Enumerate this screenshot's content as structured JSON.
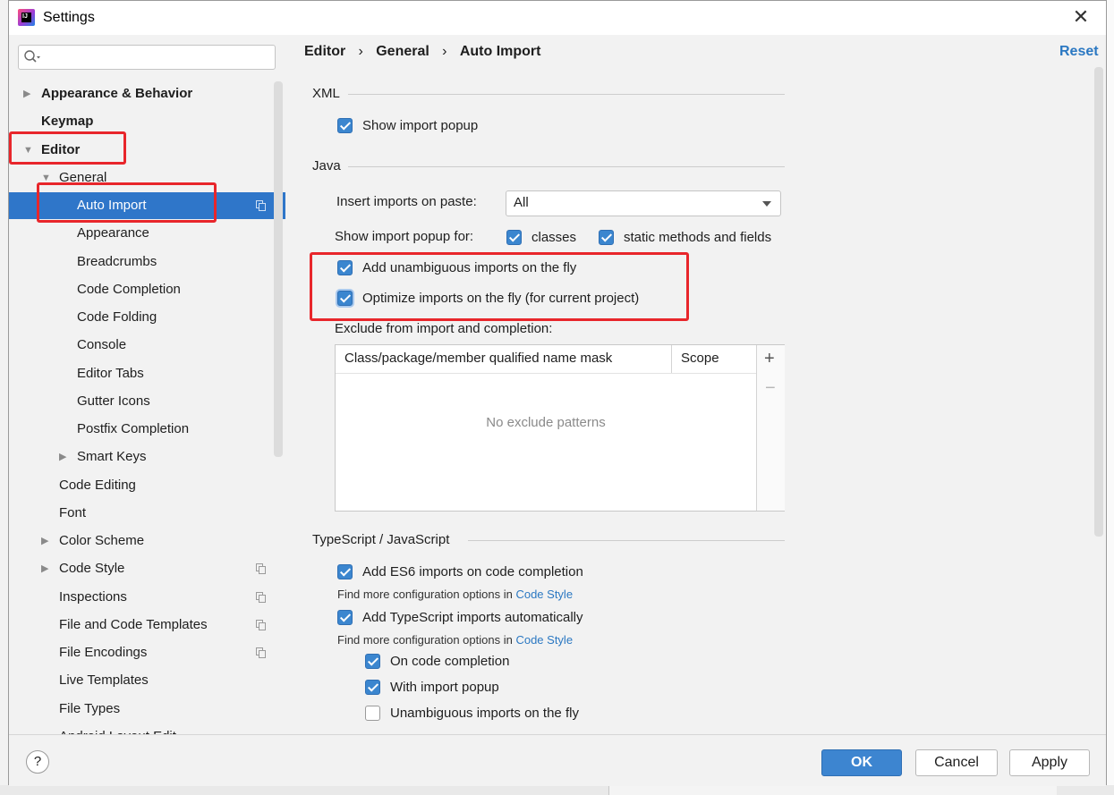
{
  "window": {
    "title": "Settings"
  },
  "search": {
    "placeholder": ""
  },
  "tree": {
    "items": [
      {
        "label": "Appearance & Behavior"
      },
      {
        "label": "Keymap"
      },
      {
        "label": "Editor"
      },
      {
        "label": "General"
      },
      {
        "label": "Auto Import"
      },
      {
        "label": "Appearance"
      },
      {
        "label": "Breadcrumbs"
      },
      {
        "label": "Code Completion"
      },
      {
        "label": "Code Folding"
      },
      {
        "label": "Console"
      },
      {
        "label": "Editor Tabs"
      },
      {
        "label": "Gutter Icons"
      },
      {
        "label": "Postfix Completion"
      },
      {
        "label": "Smart Keys"
      },
      {
        "label": "Code Editing"
      },
      {
        "label": "Font"
      },
      {
        "label": "Color Scheme"
      },
      {
        "label": "Code Style"
      },
      {
        "label": "Inspections"
      },
      {
        "label": "File and Code Templates"
      },
      {
        "label": "File Encodings"
      },
      {
        "label": "Live Templates"
      },
      {
        "label": "File Types"
      },
      {
        "label": "Android Layout Edit..."
      }
    ]
  },
  "breadcrumb": {
    "items": [
      "Editor",
      "General",
      "Auto Import"
    ],
    "separator": "›"
  },
  "reset_label": "Reset",
  "xml": {
    "title": "XML",
    "show_import_popup": {
      "label": "Show import popup",
      "checked": true
    }
  },
  "java": {
    "title": "Java",
    "insert_imports_label": "Insert imports on paste:",
    "insert_imports_value": "All",
    "show_popup_for_label": "Show import popup for:",
    "classes": {
      "label": "classes",
      "checked": true
    },
    "static_methods": {
      "label": "static methods and fields",
      "checked": true
    },
    "add_unambiguous": {
      "label": "Add unambiguous imports on the fly",
      "checked": true
    },
    "optimize_imports": {
      "label": "Optimize imports on the fly (for current project)",
      "checked": true
    },
    "exclude_label": "Exclude from import and completion:",
    "table": {
      "columns": [
        "Class/package/member qualified name mask",
        "Scope"
      ],
      "empty_text": "No exclude patterns",
      "add": "+",
      "remove": "−"
    }
  },
  "ts": {
    "title": "TypeScript / JavaScript",
    "add_es6": {
      "label": "Add ES6 imports on code completion",
      "checked": true
    },
    "hint_prefix": "Find more configuration options in ",
    "hint_link": "Code Style",
    "add_ts": {
      "label": "Add TypeScript imports automatically",
      "checked": true
    },
    "on_completion": {
      "label": "On code completion",
      "checked": true
    },
    "with_popup": {
      "label": "With import popup",
      "checked": true
    },
    "unambiguous": {
      "label": "Unambiguous imports on the fly",
      "checked": false
    }
  },
  "footer": {
    "help": "?",
    "ok": "OK",
    "cancel": "Cancel",
    "apply": "Apply"
  },
  "colors": {
    "selection": "#2f76c9",
    "link": "#2b78c2",
    "checkbox": "#3b86cf",
    "annotation": "#e8262b"
  }
}
